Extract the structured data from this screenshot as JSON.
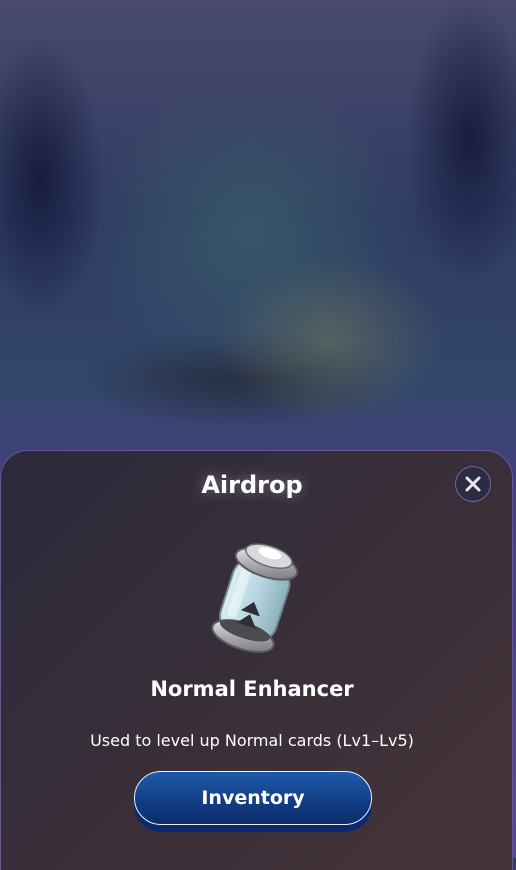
{
  "modal": {
    "title": "Airdrop",
    "close_icon": "close-icon"
  },
  "item": {
    "icon": "enhancer-canister-icon",
    "name": "Normal Enhancer",
    "description": "Used to level up Normal cards (Lv1–Lv5)"
  },
  "actions": {
    "inventory_label": "Inventory"
  },
  "colors": {
    "sheet_background": "#2c2a3c",
    "sheet_border": "#8c78dc",
    "button_primary": "#123e86",
    "text": "#ffffff"
  }
}
